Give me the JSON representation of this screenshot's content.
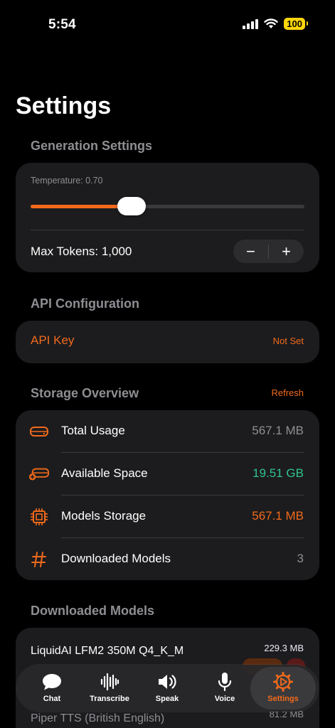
{
  "status": {
    "time": "5:54",
    "battery": "100"
  },
  "page": {
    "title": "Settings"
  },
  "generation": {
    "header": "Generation Settings",
    "temperature_label": "Temperature: 0.70",
    "temperature_fraction": 0.37,
    "max_tokens_label": "Max Tokens: 1,000",
    "decrement": "−",
    "increment": "+"
  },
  "api": {
    "header": "API Configuration",
    "key_label": "API Key",
    "key_value": "Not Set"
  },
  "storage": {
    "header": "Storage Overview",
    "refresh": "Refresh",
    "rows": [
      {
        "label": "Total Usage",
        "value": "567.1 MB",
        "icon": "drive-icon"
      },
      {
        "label": "Available Space",
        "value": "19.51 GB",
        "icon": "drive-add-icon"
      },
      {
        "label": "Models Storage",
        "value": "567.1 MB",
        "icon": "chip-icon"
      },
      {
        "label": "Downloaded Models",
        "value": "3",
        "icon": "hash-icon"
      }
    ]
  },
  "downloaded": {
    "header": "Downloaded Models",
    "models": [
      {
        "name": "LiquidAI LFM2 350M Q4_K_M",
        "size": "229.3 MB"
      },
      {
        "name": "Piper TTS (British English)",
        "size": "81.2 MB"
      }
    ]
  },
  "tabs": [
    {
      "label": "Chat",
      "icon": "chat-bubble-icon"
    },
    {
      "label": "Transcribe",
      "icon": "waveform-icon"
    },
    {
      "label": "Speak",
      "icon": "speaker-icon"
    },
    {
      "label": "Voice",
      "icon": "microphone-icon"
    },
    {
      "label": "Settings",
      "icon": "gear-icon",
      "active": true
    }
  ],
  "colors": {
    "accent": "#f26a1b",
    "positive": "#30c48d",
    "background": "#000000",
    "card": "#1c1c1e"
  }
}
